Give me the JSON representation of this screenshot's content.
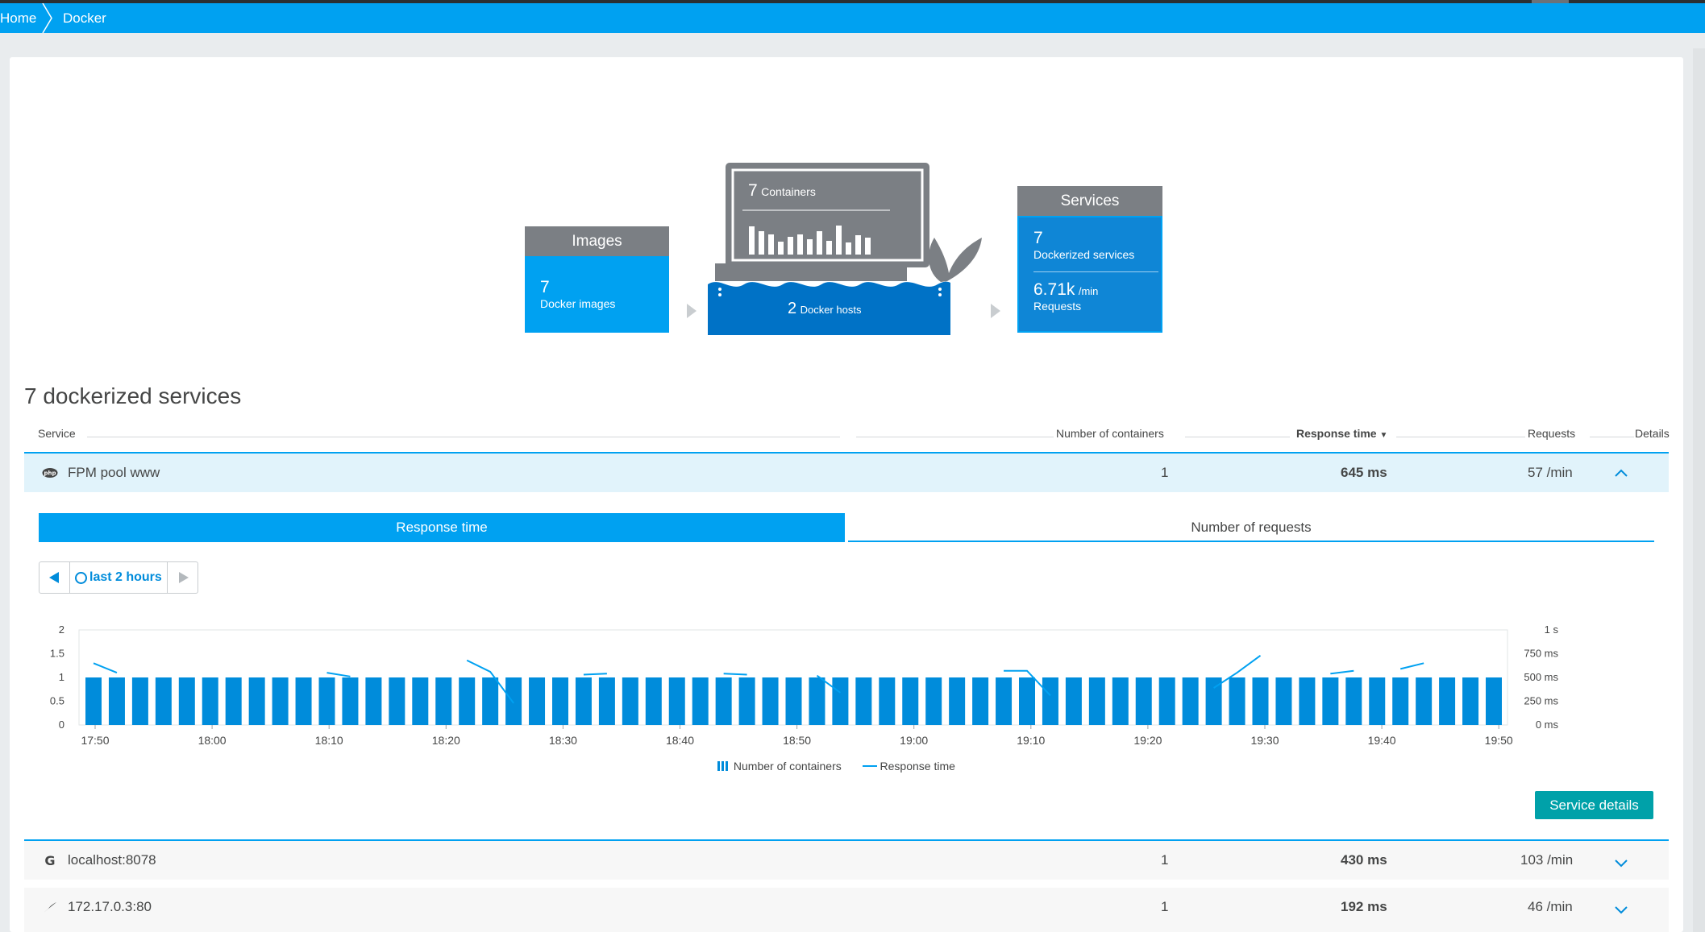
{
  "breadcrumb": {
    "home": "Home",
    "current": "Docker"
  },
  "overview": {
    "images": {
      "title": "Images",
      "count": "7",
      "label": "Docker images"
    },
    "containers": {
      "count": "7",
      "label": "Containers",
      "hosts_count": "2",
      "hosts_label": "Docker hosts"
    },
    "services": {
      "title": "Services",
      "count": "7",
      "label": "Dockerized services",
      "requests": "6.71k",
      "requests_unit": "/min",
      "requests_label": "Requests"
    }
  },
  "section_title": "7 dockerized services",
  "table": {
    "headers": {
      "service": "Service",
      "containers": "Number of containers",
      "response": "Response time",
      "requests": "Requests",
      "details": "Details"
    },
    "rows": [
      {
        "name": "FPM pool www",
        "icon": "php-icon",
        "containers": "1",
        "response": "645 ms",
        "requests": "57 /min",
        "expanded": true
      },
      {
        "name": "localhost:8078",
        "icon": "google-icon",
        "containers": "1",
        "response": "430 ms",
        "requests": "103 /min",
        "expanded": false
      },
      {
        "name": "172.17.0.3:80",
        "icon": "feather-icon",
        "containers": "1",
        "response": "192 ms",
        "requests": "46 /min",
        "expanded": false
      }
    ]
  },
  "detail": {
    "tabs": [
      "Response time",
      "Number of requests"
    ],
    "timeframe": "last 2 hours",
    "service_details_button": "Service details"
  },
  "chart_data": {
    "type": "bar",
    "x": [
      "17:50",
      "18:00",
      "18:10",
      "18:20",
      "18:30",
      "18:40",
      "18:50",
      "19:00",
      "19:10",
      "19:20",
      "19:30",
      "19:40",
      "19:50"
    ],
    "left_axis_ticks": [
      "2",
      "1.5",
      "1",
      "0.5",
      "0"
    ],
    "right_axis_ticks": [
      "1 s",
      "750 ms",
      "500 ms",
      "250 ms",
      "0 ms"
    ],
    "ylim_left": [
      0,
      2
    ],
    "ylim_right_ms": [
      0,
      1000
    ],
    "legend": [
      "Number of containers",
      "Response time"
    ],
    "series": [
      {
        "name": "Number of containers",
        "values": [
          1,
          1,
          1,
          1,
          1,
          1,
          1,
          1,
          1,
          1,
          1,
          1,
          1,
          1,
          1,
          1,
          1,
          1,
          1,
          1,
          1,
          1,
          1,
          1,
          1,
          1,
          1,
          1,
          1,
          1,
          1,
          1,
          1,
          1,
          1,
          1,
          1,
          1,
          1,
          1,
          1,
          1,
          1,
          1,
          1,
          1,
          1,
          1,
          1,
          1,
          1,
          1,
          1,
          1,
          1,
          1,
          1,
          1,
          1,
          1,
          1
        ]
      },
      {
        "name": "Response time",
        "segments": [
          [
            [
              0,
              650
            ],
            [
              1,
              550
            ]
          ],
          [
            [
              10,
              550
            ],
            [
              11,
              510
            ]
          ],
          [
            [
              16,
              680
            ],
            [
              17,
              560
            ],
            [
              18,
              230
            ]
          ],
          [
            [
              21,
              530
            ],
            [
              22,
              540
            ]
          ],
          [
            [
              27,
              540
            ],
            [
              28,
              530
            ]
          ],
          [
            [
              31,
              520
            ],
            [
              32,
              340
            ]
          ],
          [
            [
              39,
              570
            ],
            [
              40,
              570
            ],
            [
              41,
              310
            ]
          ],
          [
            [
              48,
              390
            ],
            [
              49,
              550
            ],
            [
              50,
              730
            ]
          ],
          [
            [
              53,
              540
            ],
            [
              54,
              570
            ]
          ],
          [
            [
              56,
              590
            ],
            [
              57,
              650
            ]
          ]
        ]
      }
    ]
  },
  "colors": {
    "accent": "#00a1f1",
    "dark_blue": "#0072c6",
    "gray_head": "#7b7f84",
    "teal_button": "#00a1a9"
  }
}
